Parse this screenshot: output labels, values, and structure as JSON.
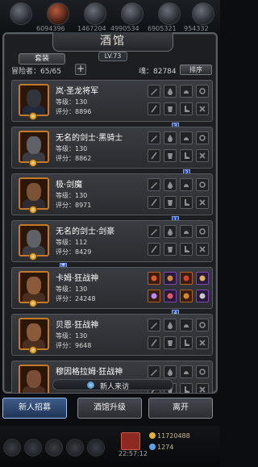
{
  "top_hud": {
    "numbers": [
      "6094396",
      "1467204",
      "4990534",
      "6905321",
      "954332"
    ]
  },
  "panel": {
    "title": "酒馆",
    "level": "LV.73",
    "tab_label": "套装",
    "add_label": "+",
    "adventurers": "冒险者：65/65",
    "souls": "魂：82784",
    "sort_label": "排序"
  },
  "heroes": [
    {
      "name": "岚·圣龙将军",
      "level": "等级：130",
      "score": "评分：8896",
      "rank": "3",
      "slots": "empty"
    },
    {
      "name": "无名的剑士·黑骑士",
      "level": "等级：130",
      "score": "评分：8862",
      "rank": "2",
      "slots": "empty"
    },
    {
      "name": "极·剑魔",
      "level": "等级：130",
      "score": "评分：8971",
      "rank": "1",
      "slots": "empty"
    },
    {
      "name": "无名的剑士·剑豪",
      "level": "等级：112",
      "score": "评分：8429",
      "rank": "贵",
      "slots": "empty"
    },
    {
      "name": "卡姆·狂战神",
      "level": "等级：130",
      "score": "评分：24248",
      "rank": "4",
      "slots": "equipped"
    },
    {
      "name": "贝恩·狂战神",
      "level": "等级：130",
      "score": "评分：9648",
      "rank": "",
      "slots": "empty"
    },
    {
      "name": "穆因格拉姆·狂战神",
      "level": "",
      "score": "",
      "rank": "",
      "slots": "empty"
    }
  ],
  "footer": {
    "visitor_label": "新人来访",
    "btn_recruit": "新人招募",
    "btn_upgrade": "酒馆升级",
    "btn_leave": "离开"
  },
  "bottom_hud": {
    "time": "22:57:12",
    "gold": "11720488",
    "gems": "1274"
  },
  "colors": {
    "portrait_border": "#c47a28",
    "rank_chip": "#2a4aa8",
    "active_button": "#3d5c88"
  }
}
